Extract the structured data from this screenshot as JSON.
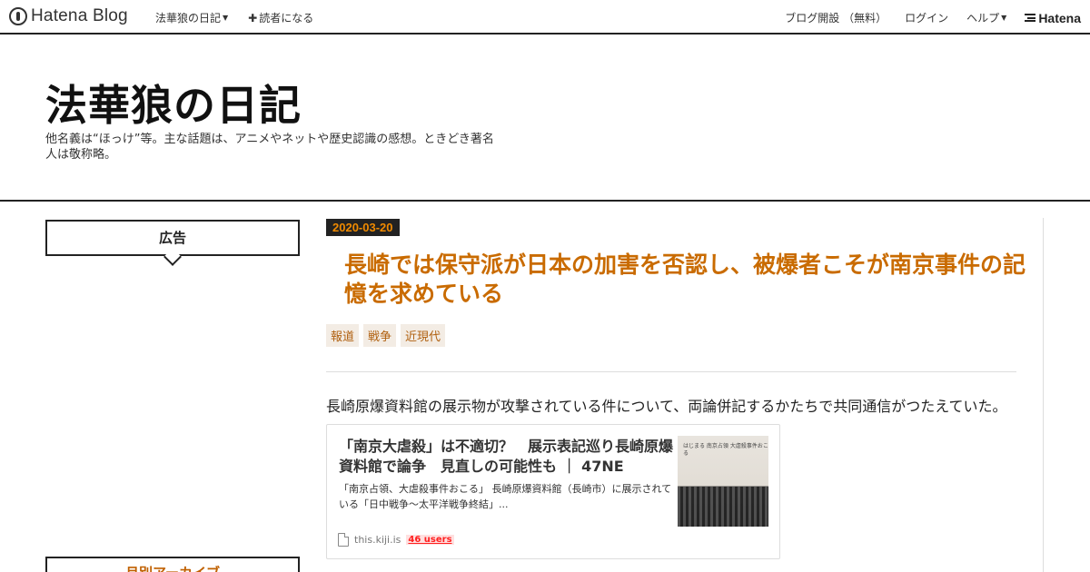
{
  "topbar": {
    "logo_text": "Hatena Blog",
    "blog_menu_label": "法華狼の日記",
    "subscribe_label": "読者になる",
    "open_blog_label": "ブログ開設 （無料）",
    "login_label": "ログイン",
    "help_label": "ヘルプ",
    "hatena_label": "Hatena"
  },
  "header": {
    "title": "法華狼の日記",
    "description": "他名義は“ほっけ”等。主な話題は、アニメやネットや歴史認識の感想。ときどき著名人は敬称略。"
  },
  "sidebar": {
    "ad_title": "広告",
    "archive_title": "月別アーカイブ"
  },
  "entry": {
    "date": "2020-03-20",
    "title": "長崎では保守派が日本の加害を否認し、被爆者こそが南京事件の記憶を求めている",
    "tags": [
      "報道",
      "戦争",
      "近現代"
    ],
    "body": "長崎原爆資料館の展示物が攻撃されている件について、両論併記するかたちで共同通信がつたえていた。"
  },
  "card": {
    "title": "「南京大虐殺」は不適切？　展示表記巡り長崎原爆資料館で論争　見直しの可能性も ｜ 47NE",
    "description": "「南京占領、大虐殺事件おこる」 長崎原爆資料館（長崎市）に展示されている「日中戦争～太平洋戦争終結」...",
    "thumb_caption": "はじまる 南京占領 大虐殺事件おこる",
    "source": "this.kiji.is",
    "users": "46 users"
  },
  "colors": {
    "accent": "#c96b00",
    "date_fg": "#f08a00",
    "users_red": "#ff2020"
  }
}
